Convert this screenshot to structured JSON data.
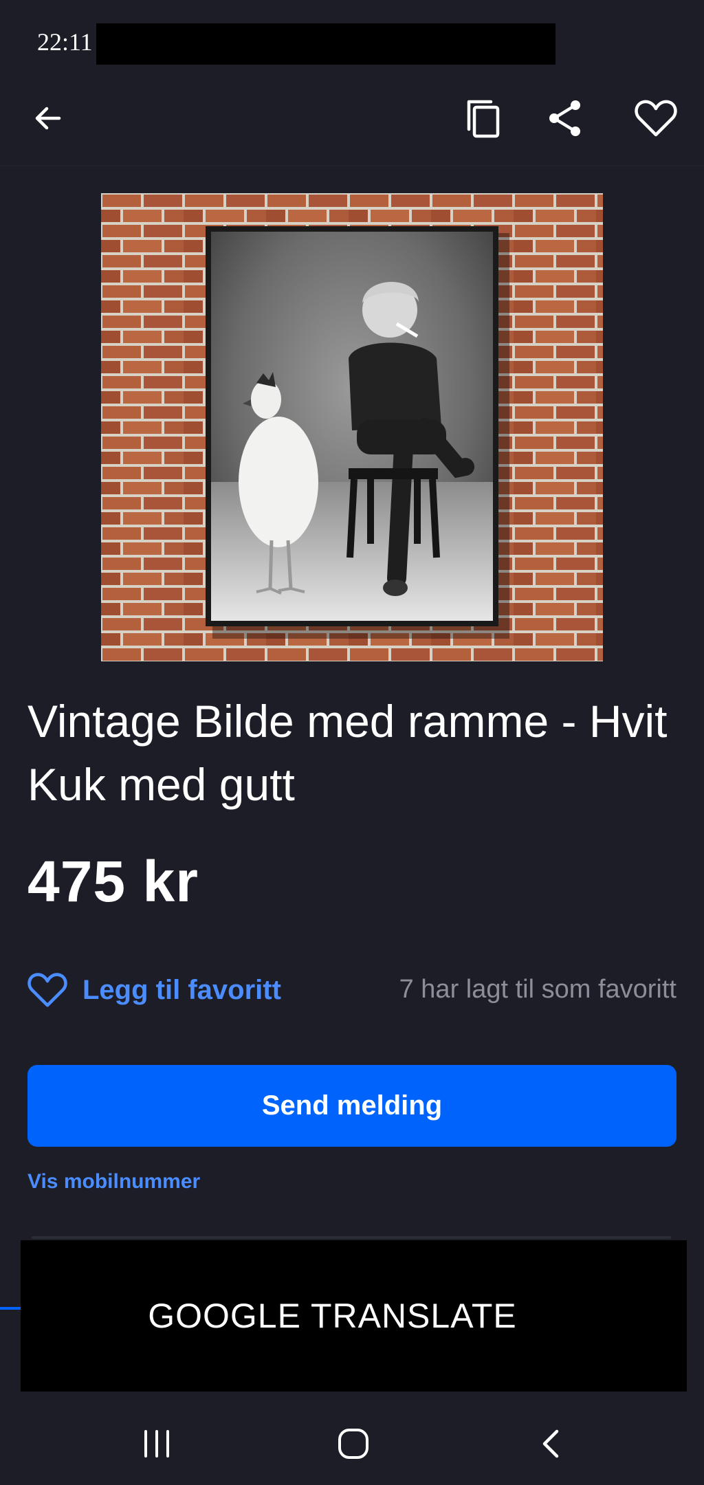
{
  "status_bar": {
    "time": "22:11"
  },
  "top_bar": {
    "back_icon": "arrow-left-icon",
    "copy_icon": "copy-icon",
    "share_icon": "share-icon",
    "favorite_icon": "heart-outline-icon"
  },
  "listing": {
    "title": "Vintage Bilde med ramme - Hvit Kuk med gutt",
    "price": "475 kr",
    "favorite_label": "Legg til favoritt",
    "favorite_count_text": "7 har lagt til som favoritt",
    "send_button_label": "Send melding",
    "phone_link_label": "Vis mobilnummer"
  },
  "overlay": {
    "banner_text": "GOOGLE TRANSLATE"
  },
  "nav_bar": {
    "recents_icon": "recents-icon",
    "home_icon": "home-icon",
    "back_icon": "nav-back-icon"
  },
  "colors": {
    "background": "#1c1d26",
    "accent": "#0063fb",
    "link": "#4b8dff",
    "muted_text": "#8c8e98"
  }
}
